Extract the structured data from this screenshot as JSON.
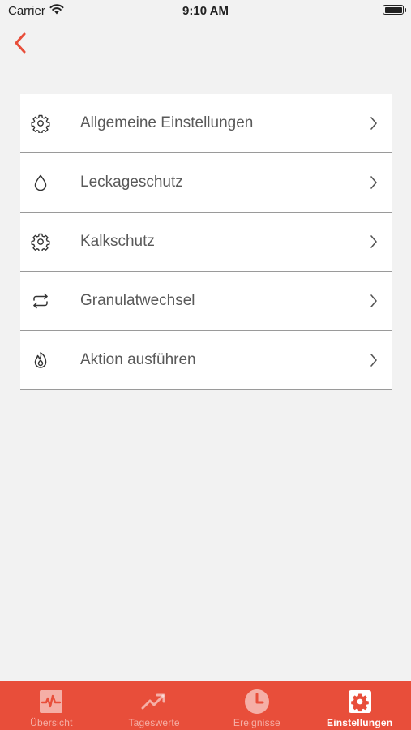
{
  "status_bar": {
    "carrier": "Carrier",
    "time": "9:10 AM"
  },
  "colors": {
    "accent": "#e84e3a",
    "background": "#f2f2f2",
    "label": "#595959"
  },
  "menu": {
    "items": [
      {
        "label": "Allgemeine Einstellungen",
        "icon": "gear-icon"
      },
      {
        "label": "Leckageschutz",
        "icon": "water-drop-icon"
      },
      {
        "label": "Kalkschutz",
        "icon": "gear-icon"
      },
      {
        "label": "Granulatwechsel",
        "icon": "exchange-arrows-icon"
      },
      {
        "label": "Aktion ausführen",
        "icon": "flame-icon"
      }
    ]
  },
  "tab_bar": {
    "tabs": [
      {
        "label": "Übersicht",
        "icon": "pulse-icon",
        "active": false
      },
      {
        "label": "Tageswerte",
        "icon": "trend-up-icon",
        "active": false
      },
      {
        "label": "Ereignisse",
        "icon": "clock-icon",
        "active": false
      },
      {
        "label": "Einstellungen",
        "icon": "settings-gear-icon",
        "active": true
      }
    ]
  }
}
